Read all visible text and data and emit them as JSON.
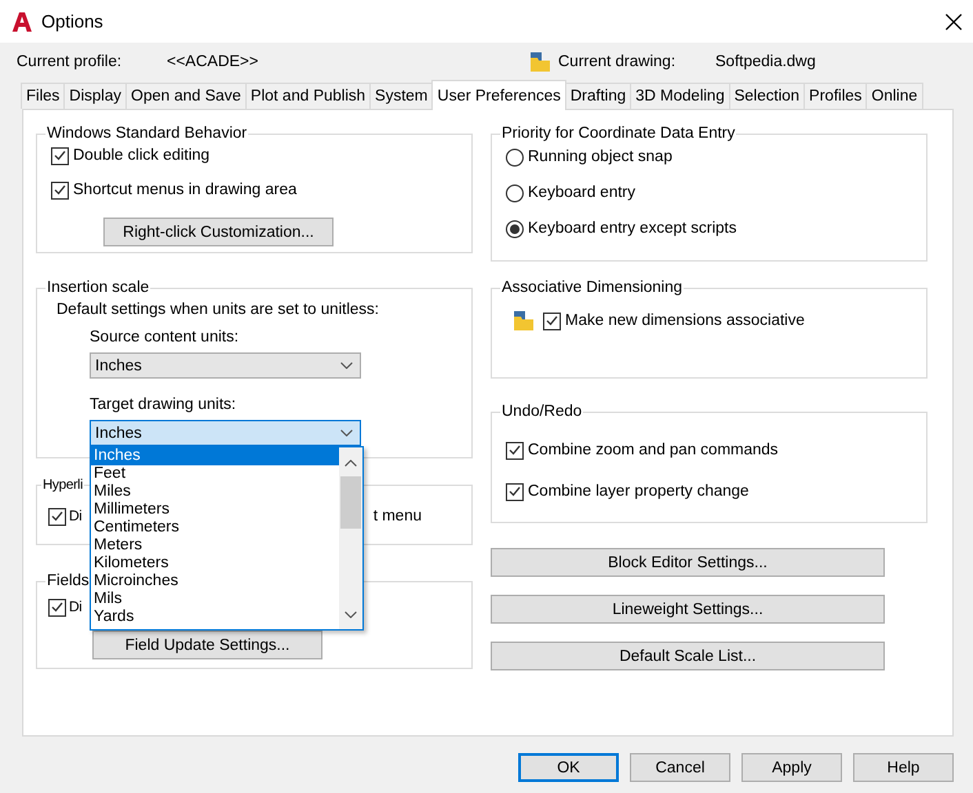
{
  "window": {
    "title": "Options"
  },
  "profile": {
    "label": "Current profile:",
    "value": "<<ACADE>>"
  },
  "drawing": {
    "label": "Current drawing:",
    "value": "Softpedia.dwg"
  },
  "tabs": [
    {
      "label": "Files",
      "selected": false
    },
    {
      "label": "Display",
      "selected": false
    },
    {
      "label": "Open and Save",
      "selected": false
    },
    {
      "label": "Plot and Publish",
      "selected": false
    },
    {
      "label": "System",
      "selected": false
    },
    {
      "label": "User Preferences",
      "selected": true
    },
    {
      "label": "Drafting",
      "selected": false
    },
    {
      "label": "3D Modeling",
      "selected": false
    },
    {
      "label": "Selection",
      "selected": false
    },
    {
      "label": "Profiles",
      "selected": false
    },
    {
      "label": "Online",
      "selected": false
    }
  ],
  "windows_standard_behavior": {
    "title": "Windows Standard Behavior",
    "checkboxes": [
      {
        "label": "Double click editing",
        "checked": true
      },
      {
        "label": "Shortcut menus in drawing area",
        "checked": true
      }
    ],
    "button": "Right-click Customization..."
  },
  "insertion_scale": {
    "title": "Insertion scale",
    "description": "Default settings when units are set to unitless:",
    "source": {
      "label": "Source content units:",
      "value": "Inches"
    },
    "target": {
      "label": "Target drawing units:",
      "value": "Inches",
      "expanded": true,
      "options": [
        {
          "label": "Inches",
          "selected": true
        },
        {
          "label": "Feet",
          "selected": false
        },
        {
          "label": "Miles",
          "selected": false
        },
        {
          "label": "Millimeters",
          "selected": false
        },
        {
          "label": "Centimeters",
          "selected": false
        },
        {
          "label": "Meters",
          "selected": false
        },
        {
          "label": "Kilometers",
          "selected": false
        },
        {
          "label": "Microinches",
          "selected": false
        },
        {
          "label": "Mils",
          "selected": false
        },
        {
          "label": "Yards",
          "selected": false
        }
      ]
    }
  },
  "hyperlink": {
    "title": "Hyperli",
    "checkbox": {
      "label": "Di",
      "checked": true
    },
    "trailing_text": "t menu"
  },
  "fields": {
    "title": "Fields",
    "checkbox": {
      "label": "Di",
      "checked": true
    },
    "button": "Field Update Settings..."
  },
  "priority": {
    "title": "Priority for Coordinate Data Entry",
    "options": [
      {
        "label": "Running object snap",
        "selected": false
      },
      {
        "label": "Keyboard entry",
        "selected": false
      },
      {
        "label": "Keyboard entry except scripts",
        "selected": true
      }
    ]
  },
  "associative_dimensioning": {
    "title": "Associative Dimensioning",
    "checkbox": {
      "label": "Make new dimensions associative",
      "checked": true
    }
  },
  "undo_redo": {
    "title": "Undo/Redo",
    "checkboxes": [
      {
        "label": "Combine zoom and pan commands",
        "checked": true
      },
      {
        "label": "Combine layer property change",
        "checked": true
      }
    ]
  },
  "settings_buttons": [
    "Block Editor Settings...",
    "Lineweight Settings...",
    "Default Scale List..."
  ],
  "footer_buttons": [
    {
      "label": "OK",
      "default": true
    },
    {
      "label": "Cancel",
      "default": false
    },
    {
      "label": "Apply",
      "default": false
    },
    {
      "label": "Help",
      "default": false
    }
  ]
}
